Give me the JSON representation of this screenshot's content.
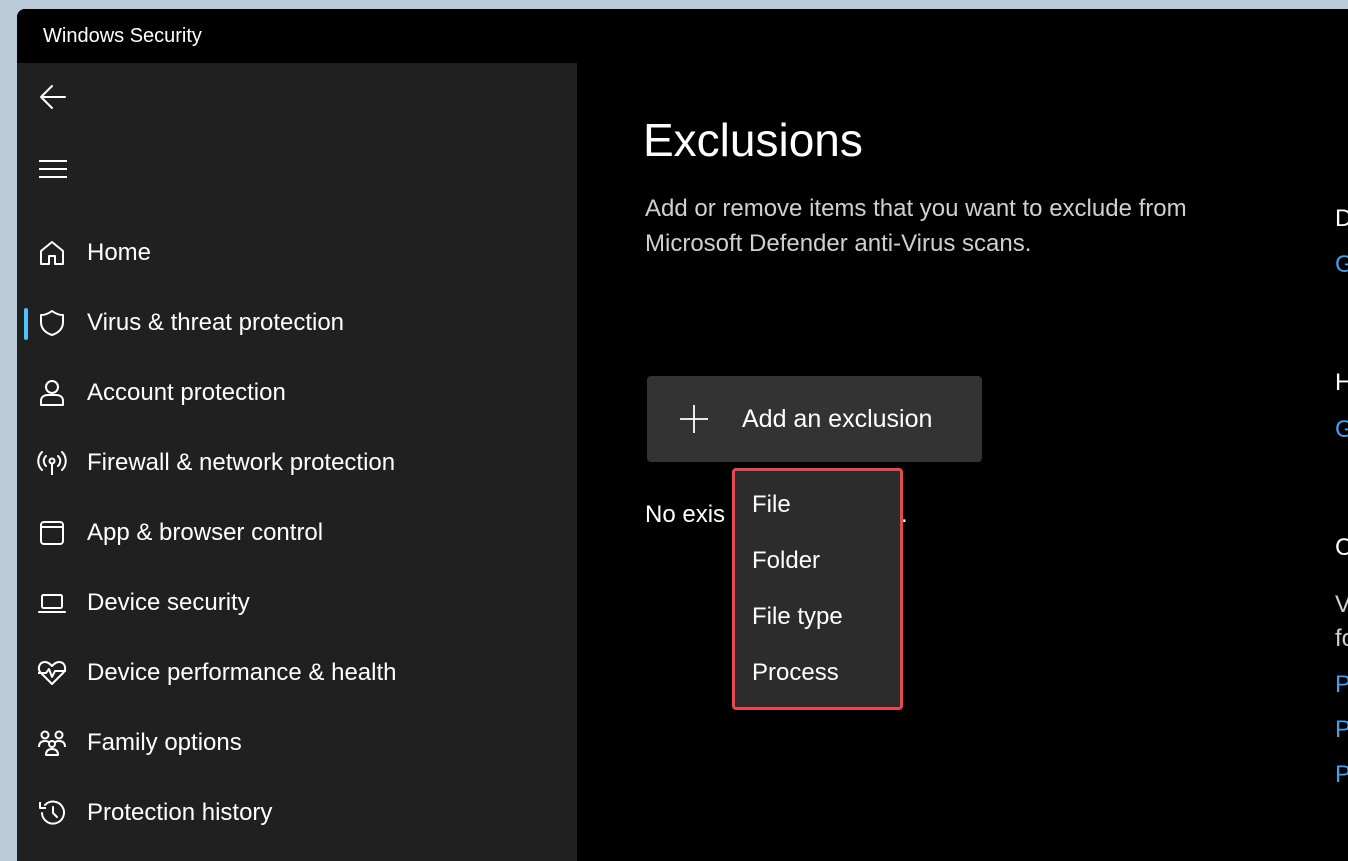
{
  "window": {
    "title": "Windows Security"
  },
  "sidebar": {
    "back_icon": "back-arrow-icon",
    "menu_icon": "hamburger-menu-icon",
    "items": [
      {
        "label": "Home",
        "icon": "home-icon",
        "active": false
      },
      {
        "label": "Virus & threat protection",
        "icon": "shield-icon",
        "active": true
      },
      {
        "label": "Account protection",
        "icon": "person-icon",
        "active": false
      },
      {
        "label": "Firewall & network protection",
        "icon": "antenna-icon",
        "active": false
      },
      {
        "label": "App & browser control",
        "icon": "app-window-icon",
        "active": false
      },
      {
        "label": "Device security",
        "icon": "laptop-icon",
        "active": false
      },
      {
        "label": "Device performance & health",
        "icon": "heart-pulse-icon",
        "active": false
      },
      {
        "label": "Family options",
        "icon": "family-icon",
        "active": false
      },
      {
        "label": "Protection history",
        "icon": "history-icon",
        "active": false
      }
    ]
  },
  "main": {
    "title": "Exclusions",
    "description": "Add or remove items that you want to exclude from Microsoft Defender anti-Virus scans.",
    "add_button_label": "Add an exclusion",
    "empty_text": "No exis",
    "empty_text_tail": "."
  },
  "dropdown": {
    "items": [
      "File",
      "Folder",
      "File type",
      "Process"
    ]
  },
  "right_column": {
    "fragments": [
      "D",
      "G",
      "H",
      "G",
      "C",
      "V",
      "fo",
      "P",
      "P",
      "P"
    ]
  },
  "colors": {
    "accent": "#4cc2ff",
    "link": "#4a9de8",
    "highlight_border": "#e04a50",
    "sidebar_bg": "#202020",
    "main_bg": "#000000"
  }
}
